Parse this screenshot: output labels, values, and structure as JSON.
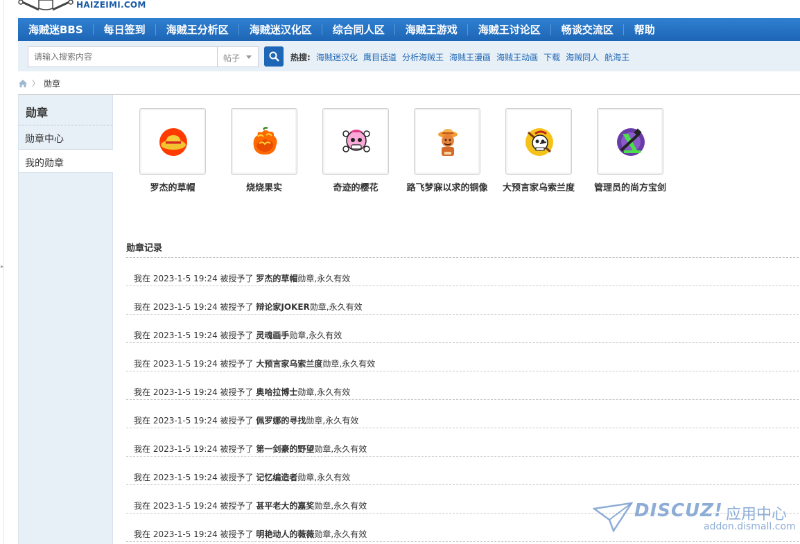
{
  "site": {
    "logo_text": "HAIZEIMI.COM"
  },
  "nav": {
    "items": [
      "海贼迷BBS",
      "每日签到",
      "海贼王分析区",
      "海贼迷汉化区",
      "综合同人区",
      "海贼王游戏",
      "海贼王讨论区",
      "畅谈交流区",
      "帮助"
    ]
  },
  "search": {
    "placeholder": "请输入搜索内容",
    "type_selected": "帖子",
    "hot_label": "热搜:",
    "hot_links": [
      "海贼迷汉化",
      "鹰目话道",
      "分析海贼王",
      "海贼王漫画",
      "海贼王动画",
      "下载",
      "海贼同人",
      "航海王"
    ]
  },
  "breadcrumb": {
    "current": "勋章"
  },
  "sidebar": {
    "title": "勋章",
    "items": [
      "勋章中心",
      "我的勋章"
    ],
    "active_index": 1
  },
  "medals": [
    {
      "name": "罗杰的草帽",
      "icon": "straw-hat-icon"
    },
    {
      "name": "烧烧果实",
      "icon": "devil-fruit-icon"
    },
    {
      "name": "奇迹的樱花",
      "icon": "pink-jolly-roger-icon"
    },
    {
      "name": "路飞梦寐以求的铜像",
      "icon": "luffy-statue-icon"
    },
    {
      "name": "大预言家乌索兰度",
      "icon": "usopp-jolly-roger-icon"
    },
    {
      "name": "管理员的尚方宝剑",
      "icon": "admin-sword-icon"
    }
  ],
  "records": {
    "title": "勋章记录",
    "prefix": "我在",
    "granted": "被授予了",
    "suffix": "勋章,永久有效",
    "items": [
      {
        "time": "2023-1-5 19:24",
        "medal": "罗杰的草帽"
      },
      {
        "time": "2023-1-5 19:24",
        "medal": "辩论家JOKER"
      },
      {
        "time": "2023-1-5 19:24",
        "medal": "灵魂画手"
      },
      {
        "time": "2023-1-5 19:24",
        "medal": "大预言家乌索兰度"
      },
      {
        "time": "2023-1-5 19:24",
        "medal": "奥哈拉博士"
      },
      {
        "time": "2023-1-5 19:24",
        "medal": "佩罗娜的寻找"
      },
      {
        "time": "2023-1-5 19:24",
        "medal": "第一剑豪的野望"
      },
      {
        "time": "2023-1-5 19:24",
        "medal": "记忆编造者"
      },
      {
        "time": "2023-1-5 19:24",
        "medal": "甚平老大的嘉奖"
      },
      {
        "time": "2023-1-5 19:24",
        "medal": "明艳动人的薇薇"
      }
    ]
  },
  "watermark": {
    "brand": "DISCUZ!",
    "cn": "应用中心",
    "url": "addon.dismall.com"
  },
  "colors": {
    "nav_bg": "#1e66b6",
    "link": "#1e66b6",
    "sidebar_bg": "#e8f0f7"
  }
}
